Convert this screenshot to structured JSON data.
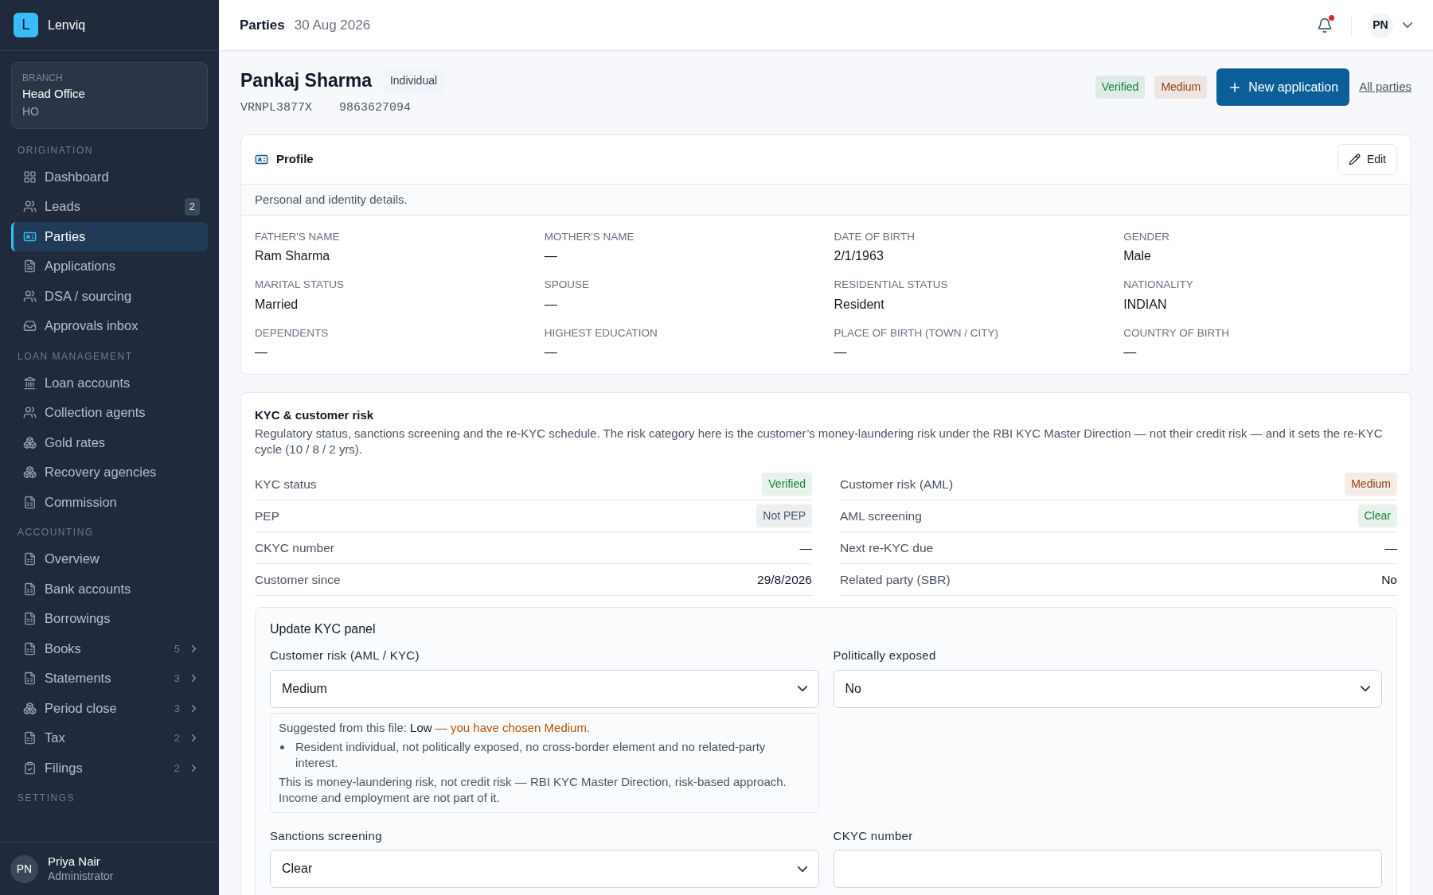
{
  "brand": {
    "logo": "L",
    "name": "Lenviq"
  },
  "branch": {
    "label": "BRANCH",
    "name": "Head Office",
    "code": "HO"
  },
  "sidebar": {
    "sections": [
      {
        "title": "ORIGINATION",
        "items": [
          {
            "label": "Dashboard",
            "selected": false
          },
          {
            "label": "Leads",
            "selected": false,
            "badge": "2"
          },
          {
            "label": "Parties",
            "selected": true
          },
          {
            "label": "Applications",
            "selected": false
          },
          {
            "label": "DSA / sourcing",
            "selected": false
          },
          {
            "label": "Approvals inbox",
            "selected": false
          }
        ]
      },
      {
        "title": "LOAN MANAGEMENT",
        "items": [
          {
            "label": "Loan accounts",
            "selected": false
          },
          {
            "label": "Collection agents",
            "selected": false
          },
          {
            "label": "Gold rates",
            "selected": false
          },
          {
            "label": "Recovery agencies",
            "selected": false
          },
          {
            "label": "Commission",
            "selected": false
          }
        ]
      },
      {
        "title": "ACCOUNTING",
        "items": [
          {
            "label": "Overview",
            "selected": false
          },
          {
            "label": "Bank accounts",
            "selected": false
          },
          {
            "label": "Borrowings",
            "selected": false
          },
          {
            "label": "Books",
            "selected": false,
            "count": "5"
          },
          {
            "label": "Statements",
            "selected": false,
            "count": "3"
          },
          {
            "label": "Period close",
            "selected": false,
            "count": "3"
          },
          {
            "label": "Tax",
            "selected": false,
            "count": "2"
          },
          {
            "label": "Filings",
            "selected": false,
            "count": "2"
          }
        ]
      },
      {
        "title": "SETTINGS"
      }
    ]
  },
  "user": {
    "initials": "PN",
    "name": "Priya Nair",
    "role": "Administrator"
  },
  "topbar": {
    "title": "Parties",
    "date": "30 Aug 2026",
    "has_notification": true,
    "initials": "PN"
  },
  "party": {
    "name": "Pankaj Sharma",
    "type": "Individual",
    "pan": "VRNPL3877X",
    "phone": "9863627094",
    "badges": [
      {
        "label": "Verified",
        "color": "#15803d"
      },
      {
        "label": "Medium",
        "color": "#92400e"
      }
    ],
    "primary_action": "New application",
    "link": "All parties"
  },
  "profile": {
    "title": "Profile",
    "edit": "Edit",
    "description": "Personal and identity details.",
    "fields": [
      {
        "label": "FATHER'S NAME",
        "value": "Ram Sharma"
      },
      {
        "label": "MOTHER'S NAME",
        "value": "—"
      },
      {
        "label": "DATE OF BIRTH",
        "value": "2/1/1963"
      },
      {
        "label": "GENDER",
        "value": "Male"
      },
      {
        "label": "MARITAL STATUS",
        "value": "Married"
      },
      {
        "label": "SPOUSE",
        "value": "—"
      },
      {
        "label": "RESIDENTIAL STATUS",
        "value": "Resident"
      },
      {
        "label": "NATIONALITY",
        "value": "INDIAN"
      },
      {
        "label": "DEPENDENTS",
        "value": "—"
      },
      {
        "label": "HIGHEST EDUCATION",
        "value": "—"
      },
      {
        "label": "PLACE OF BIRTH (TOWN / CITY)",
        "value": "—"
      },
      {
        "label": "COUNTRY OF BIRTH",
        "value": "—"
      }
    ]
  },
  "kyc": {
    "title": "KYC & customer risk",
    "description": "Regulatory status, sanctions screening and the re-KYC schedule. The risk category here is the customer’s money-laundering risk under the RBI KYC Master Direction — not their credit risk — and it sets the re-KYC cycle (10 / 8 / 2 yrs).",
    "rows": [
      {
        "label": "KYC status",
        "value": "Verified",
        "kind": "badge",
        "color": "#15803d"
      },
      {
        "label": "Customer risk (AML)",
        "value": "Medium",
        "kind": "badge",
        "color": "#92400e"
      },
      {
        "label": "PEP",
        "value": "Not PEP",
        "kind": "badge",
        "color": "#475569"
      },
      {
        "label": "AML screening",
        "value": "Clear",
        "kind": "badge",
        "color": "#15803d"
      },
      {
        "label": "CKYC number",
        "value": "—",
        "kind": "text"
      },
      {
        "label": "Next re-KYC due",
        "value": "—",
        "kind": "text"
      },
      {
        "label": "Customer since",
        "value": "29/8/2026",
        "kind": "text"
      },
      {
        "label": "Related party (SBR)",
        "value": "No",
        "kind": "text"
      }
    ],
    "panel": {
      "title": "Update KYC panel",
      "fields": [
        {
          "label": "Customer risk (AML / KYC)",
          "kind": "select",
          "value": "Medium",
          "suggestion": {
            "prefix": "Suggested from this file:",
            "value": "Low",
            "warning": "— you have chosen Medium.",
            "bullets": [
              "Resident individual, not politically exposed, no cross-border element and no related-party interest."
            ],
            "note": "This is money-laundering risk, not credit risk — RBI KYC Master Direction, risk-based approach. Income and employment are not part of it."
          }
        },
        {
          "label": "Politically exposed",
          "kind": "select",
          "value": "No"
        },
        {
          "label": "Sanctions screening",
          "kind": "select",
          "value": "Clear"
        },
        {
          "label": "CKYC number",
          "kind": "input"
        }
      ]
    }
  }
}
